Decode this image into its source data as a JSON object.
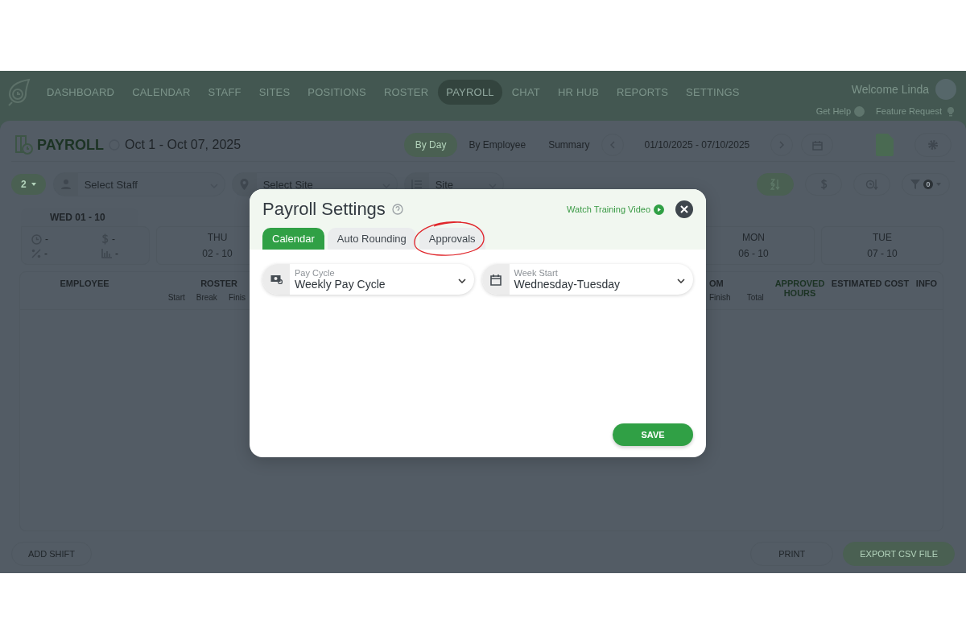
{
  "nav": {
    "items": [
      {
        "label": "DASHBOARD",
        "selected": false
      },
      {
        "label": "CALENDAR",
        "selected": false
      },
      {
        "label": "STAFF",
        "selected": false
      },
      {
        "label": "SITES",
        "selected": false
      },
      {
        "label": "POSITIONS",
        "selected": false
      },
      {
        "label": "ROSTER",
        "selected": false
      },
      {
        "label": "PAYROLL",
        "selected": true
      },
      {
        "label": "CHAT",
        "selected": false
      },
      {
        "label": "HR HUB",
        "selected": false
      },
      {
        "label": "REPORTS",
        "selected": false
      },
      {
        "label": "SETTINGS",
        "selected": false
      }
    ],
    "welcome": "Welcome Linda",
    "help_link": "Get Help",
    "feature_link": "Feature Request"
  },
  "header": {
    "title": "PAYROLL",
    "period": "Oct 1 - Oct 07, 2025",
    "views": [
      {
        "label": "By Day",
        "selected": true
      },
      {
        "label": "By Employee",
        "selected": false
      },
      {
        "label": "Summary",
        "selected": false
      }
    ],
    "date_range": "01/10/2025 - 07/10/2025"
  },
  "filters": {
    "count": "2",
    "staff_placeholder": "Select Staff",
    "site_placeholder": "Select Site",
    "group_by": "Site",
    "filter_count": "0"
  },
  "selected_day": {
    "label": "WED 01 - 10",
    "stats": [
      "-",
      "-",
      "-",
      "-"
    ]
  },
  "days": [
    {
      "weekday": "THU",
      "date": "02 - 10"
    },
    {
      "weekday": "MON",
      "date": "06 - 10"
    },
    {
      "weekday": "TUE",
      "date": "07 - 10"
    }
  ],
  "table": {
    "columns": [
      {
        "label": "EMPLOYEE"
      },
      {
        "label": "ROSTER",
        "sub": [
          "Start",
          "Break",
          "Finis"
        ]
      },
      {
        "label": "OM",
        "sub": [
          "Finish",
          "Total"
        ]
      },
      {
        "label": "APPROVED HOURS"
      },
      {
        "label": "ESTIMATED COST"
      },
      {
        "label": "INFO"
      }
    ]
  },
  "footer": {
    "add_shift": "ADD SHIFT",
    "print": "PRINT",
    "export": "EXPORT CSV FILE"
  },
  "modal": {
    "title": "Payroll Settings",
    "video_link": "Watch Training Video",
    "tabs": [
      {
        "label": "Calendar",
        "selected": true,
        "circled": false
      },
      {
        "label": "Auto Rounding",
        "selected": false,
        "circled": false
      },
      {
        "label": "Approvals",
        "selected": false,
        "circled": true
      }
    ],
    "fields": [
      {
        "kind": "money",
        "label": "Pay Cycle",
        "value": "Weekly Pay Cycle"
      },
      {
        "kind": "calendar",
        "label": "Week Start",
        "value": "Wednesday-Tuesday"
      }
    ],
    "save": "SAVE"
  }
}
